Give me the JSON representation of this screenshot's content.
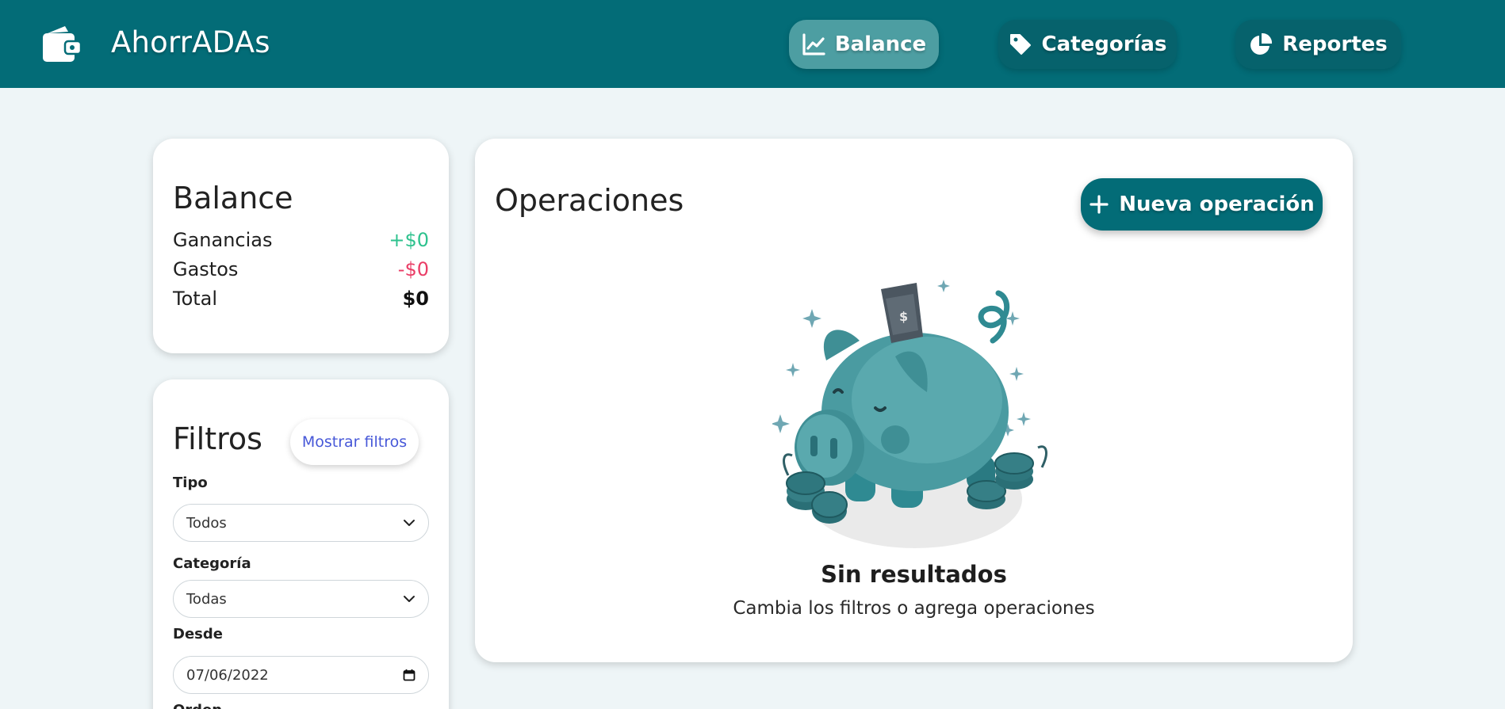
{
  "app": {
    "title": "AhorrADAs",
    "brand_icon": "wallet-icon"
  },
  "nav": {
    "items": [
      {
        "label": "Balance",
        "icon": "chart-line-icon",
        "active": true
      },
      {
        "label": "Categorías",
        "icon": "tag-icon",
        "active": false
      },
      {
        "label": "Reportes",
        "icon": "pie-chart-icon",
        "active": false
      }
    ]
  },
  "balance": {
    "title": "Balance",
    "rows": [
      {
        "label": "Ganancias",
        "value": "+$0",
        "color": "#2ec28e"
      },
      {
        "label": "Gastos",
        "value": "-$0",
        "color": "#ea3d66"
      },
      {
        "label": "Total",
        "value": "$0"
      }
    ]
  },
  "filters": {
    "title": "Filtros",
    "toggle_label": "Mostrar filtros",
    "tipo_label": "Tipo",
    "tipo_value": "Todos",
    "categoria_label": "Categoría",
    "categoria_value": "Todas",
    "desde_label": "Desde",
    "desde_value": "07/06/2022",
    "next_label": "Orden"
  },
  "operations": {
    "title": "Operaciones",
    "new_button_label": "Nueva operación",
    "empty_title": "Sin resultados",
    "empty_subtitle": "Cambia los filtros o agrega operaciones",
    "illustration": "piggy-bank-illustration"
  },
  "colors": {
    "primary": "#036c77",
    "nav_active": "#4d9ea2",
    "background": "#eef5f7",
    "positive": "#2ec28e",
    "negative": "#ea3d66",
    "link": "#4758d8"
  }
}
